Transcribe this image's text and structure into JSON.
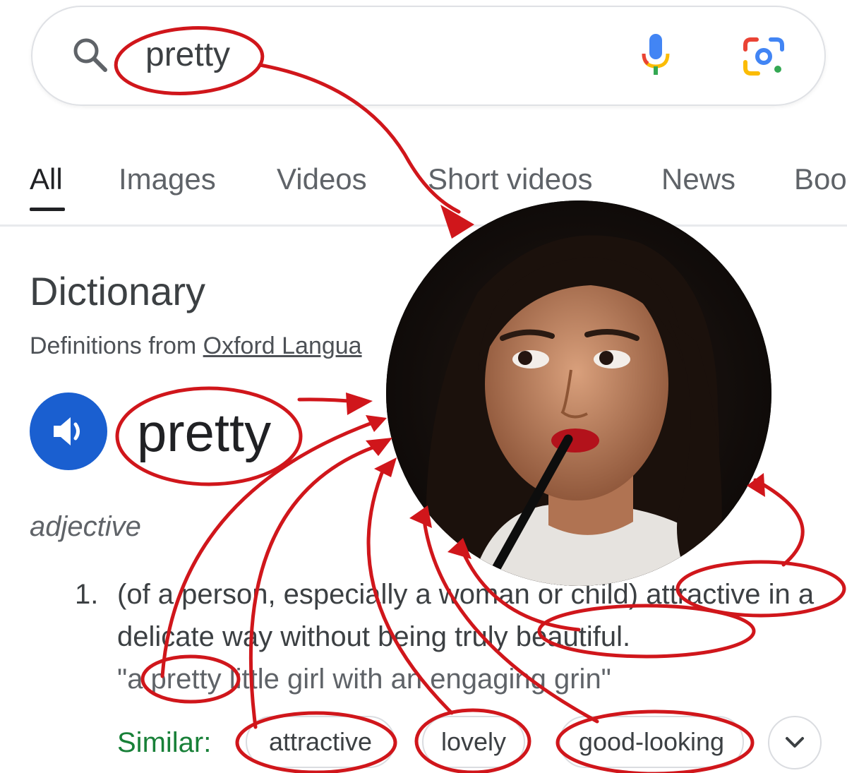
{
  "search": {
    "query": "pretty"
  },
  "tabs": [
    {
      "label": "All",
      "active": true
    },
    {
      "label": "Images"
    },
    {
      "label": "Videos"
    },
    {
      "label": "Short videos"
    },
    {
      "label": "News"
    },
    {
      "label": "Boo"
    }
  ],
  "dictionary": {
    "title": "Dictionary",
    "source_prefix": "Definitions from ",
    "source_link": "Oxford Langua",
    "headword": "pretty",
    "part_of_speech": "adjective",
    "definition_number": "1.",
    "definition": "(of a person, especially a woman or child) attractive in a delicate way without being truly beautiful.",
    "example": "\"a pretty little girl with an engaging grin\"",
    "similar_label": "Similar:",
    "similar_words": [
      "attractive",
      "lovely",
      "good-looking"
    ]
  },
  "colors": {
    "annotation_red": "#d0161b",
    "speaker_blue": "#1a5fd0",
    "similar_green": "#188038"
  },
  "icons": [
    "search-icon",
    "microphone-icon",
    "google-lens-icon",
    "speaker-icon",
    "chevron-down-icon"
  ]
}
